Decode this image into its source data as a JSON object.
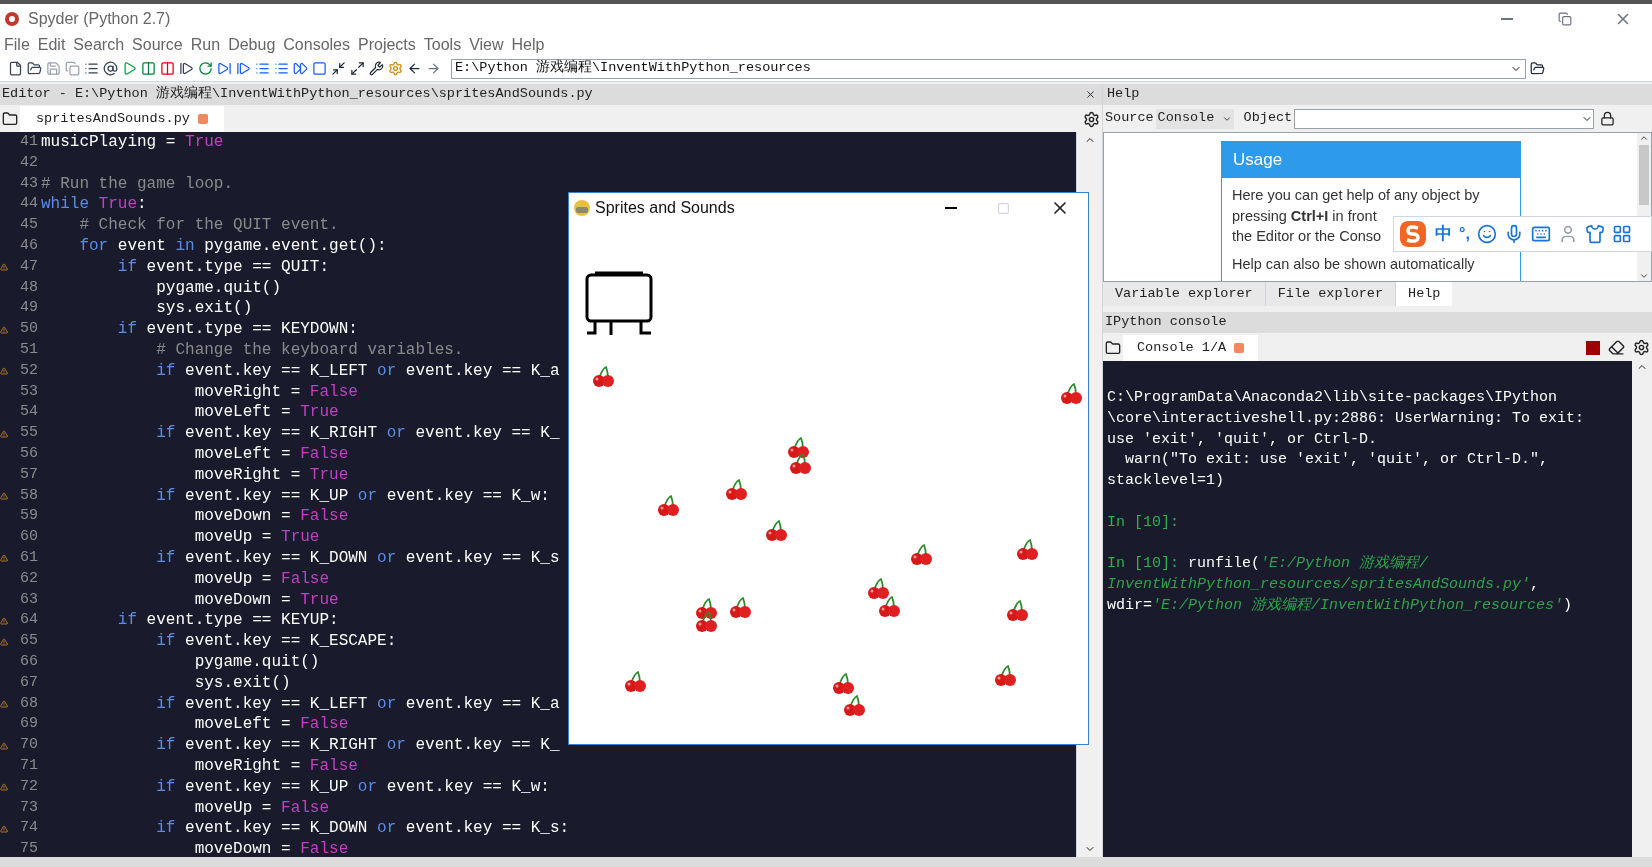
{
  "window": {
    "title": "Spyder (Python 2.7)"
  },
  "menu": [
    "File",
    "Edit",
    "Search",
    "Source",
    "Run",
    "Debug",
    "Consoles",
    "Projects",
    "Tools",
    "View",
    "Help"
  ],
  "path_field": {
    "value": "E:\\Python 游戏编程\\InventWithPython_resources"
  },
  "editor": {
    "header": "Editor - E:\\Python 游戏编程\\InventWithPython_resources\\spritesAndSounds.py",
    "tabs": [
      {
        "label": "spritesAndSounds.py",
        "selected": true
      }
    ],
    "lines": [
      {
        "n": "41",
        "warning": false,
        "tokens": [
          {
            "kind": "plain",
            "text": "musicPlaying = "
          },
          {
            "kind": "const",
            "text": "True"
          }
        ]
      },
      {
        "n": "42",
        "warning": false
      },
      {
        "n": "43",
        "warning": false,
        "tokens": [
          {
            "kind": "comment",
            "text": "# Run the game loop."
          }
        ]
      },
      {
        "n": "44",
        "warning": false,
        "tokens": [
          {
            "kind": "kw",
            "text": "while "
          },
          {
            "kind": "const",
            "text": "True"
          },
          {
            "kind": "plain",
            "text": ":"
          }
        ]
      },
      {
        "n": "45",
        "warning": false,
        "tokens": [
          {
            "kind": "comment",
            "text": "    # Check for the QUIT event."
          }
        ]
      },
      {
        "n": "46",
        "warning": false,
        "tokens": [
          {
            "kind": "kw",
            "text": "    for"
          },
          {
            "kind": "plain",
            "text": " event "
          },
          {
            "kind": "kw",
            "text": "in"
          },
          {
            "kind": "plain",
            "text": " pygame.event.get():"
          }
        ]
      },
      {
        "n": "47",
        "warning": true,
        "tokens": [
          {
            "kind": "kw",
            "text": "        if"
          },
          {
            "kind": "plain",
            "text": " event.type == QUIT:"
          }
        ]
      },
      {
        "n": "48",
        "warning": false,
        "tokens": [
          {
            "kind": "plain",
            "text": "            pygame.quit()"
          }
        ]
      },
      {
        "n": "49",
        "warning": false,
        "tokens": [
          {
            "kind": "plain",
            "text": "            sys.exit()"
          }
        ]
      },
      {
        "n": "50",
        "warning": true,
        "tokens": [
          {
            "kind": "kw",
            "text": "        if"
          },
          {
            "kind": "plain",
            "text": " event.type == KEYDOWN:"
          }
        ]
      },
      {
        "n": "51",
        "warning": false,
        "tokens": [
          {
            "kind": "comment",
            "text": "            # Change the keyboard variables."
          }
        ]
      },
      {
        "n": "52",
        "warning": true,
        "tokens": [
          {
            "kind": "kw",
            "text": "            if"
          },
          {
            "kind": "plain",
            "text": " event.key == K_LEFT "
          },
          {
            "kind": "kw",
            "text": "or"
          },
          {
            "kind": "plain",
            "text": " event.key == K_a"
          }
        ]
      },
      {
        "n": "53",
        "warning": false,
        "tokens": [
          {
            "kind": "plain",
            "text": "                moveRight = "
          },
          {
            "kind": "const",
            "text": "False"
          }
        ]
      },
      {
        "n": "54",
        "warning": false,
        "tokens": [
          {
            "kind": "plain",
            "text": "                moveLeft = "
          },
          {
            "kind": "const",
            "text": "True"
          }
        ]
      },
      {
        "n": "55",
        "warning": true,
        "tokens": [
          {
            "kind": "kw",
            "text": "            if"
          },
          {
            "kind": "plain",
            "text": " event.key == K_RIGHT "
          },
          {
            "kind": "kw",
            "text": "or"
          },
          {
            "kind": "plain",
            "text": " event.key == K_"
          }
        ]
      },
      {
        "n": "56",
        "warning": false,
        "tokens": [
          {
            "kind": "plain",
            "text": "                moveLeft = "
          },
          {
            "kind": "const",
            "text": "False"
          }
        ]
      },
      {
        "n": "57",
        "warning": false,
        "tokens": [
          {
            "kind": "plain",
            "text": "                moveRight = "
          },
          {
            "kind": "const",
            "text": "True"
          }
        ]
      },
      {
        "n": "58",
        "warning": true,
        "tokens": [
          {
            "kind": "kw",
            "text": "            if"
          },
          {
            "kind": "plain",
            "text": " event.key == K_UP "
          },
          {
            "kind": "kw",
            "text": "or"
          },
          {
            "kind": "plain",
            "text": " event.key == K_w:"
          }
        ]
      },
      {
        "n": "59",
        "warning": false,
        "tokens": [
          {
            "kind": "plain",
            "text": "                moveDown = "
          },
          {
            "kind": "const",
            "text": "False"
          }
        ]
      },
      {
        "n": "60",
        "warning": false,
        "tokens": [
          {
            "kind": "plain",
            "text": "                moveUp = "
          },
          {
            "kind": "const",
            "text": "True"
          }
        ]
      },
      {
        "n": "61",
        "warning": true,
        "tokens": [
          {
            "kind": "kw",
            "text": "            if"
          },
          {
            "kind": "plain",
            "text": " event.key == K_DOWN "
          },
          {
            "kind": "kw",
            "text": "or"
          },
          {
            "kind": "plain",
            "text": " event.key == K_s"
          }
        ]
      },
      {
        "n": "62",
        "warning": false,
        "tokens": [
          {
            "kind": "plain",
            "text": "                moveUp = "
          },
          {
            "kind": "const",
            "text": "False"
          }
        ]
      },
      {
        "n": "63",
        "warning": false,
        "tokens": [
          {
            "kind": "plain",
            "text": "                moveDown = "
          },
          {
            "kind": "const",
            "text": "True"
          }
        ]
      },
      {
        "n": "64",
        "warning": true,
        "tokens": [
          {
            "kind": "kw",
            "text": "        if"
          },
          {
            "kind": "plain",
            "text": " event.type == KEYUP:"
          }
        ]
      },
      {
        "n": "65",
        "warning": true,
        "tokens": [
          {
            "kind": "kw",
            "text": "            if"
          },
          {
            "kind": "plain",
            "text": " event.key == K_ESCAPE:"
          }
        ]
      },
      {
        "n": "66",
        "warning": false,
        "tokens": [
          {
            "kind": "plain",
            "text": "                pygame.quit()"
          }
        ]
      },
      {
        "n": "67",
        "warning": false,
        "tokens": [
          {
            "kind": "plain",
            "text": "                sys.exit()"
          }
        ]
      },
      {
        "n": "68",
        "warning": true,
        "tokens": [
          {
            "kind": "kw",
            "text": "            if"
          },
          {
            "kind": "plain",
            "text": " event.key == K_LEFT "
          },
          {
            "kind": "kw",
            "text": "or"
          },
          {
            "kind": "plain",
            "text": " event.key == K_a"
          }
        ]
      },
      {
        "n": "69",
        "warning": false,
        "tokens": [
          {
            "kind": "plain",
            "text": "                moveLeft = "
          },
          {
            "kind": "const",
            "text": "False"
          }
        ]
      },
      {
        "n": "70",
        "warning": true,
        "tokens": [
          {
            "kind": "kw",
            "text": "            if"
          },
          {
            "kind": "plain",
            "text": " event.key == K_RIGHT "
          },
          {
            "kind": "kw",
            "text": "or"
          },
          {
            "kind": "plain",
            "text": " event.key == K_"
          }
        ]
      },
      {
        "n": "71",
        "warning": false,
        "tokens": [
          {
            "kind": "plain",
            "text": "                moveRight = "
          },
          {
            "kind": "const",
            "text": "False"
          }
        ]
      },
      {
        "n": "72",
        "warning": true,
        "tokens": [
          {
            "kind": "kw",
            "text": "            if"
          },
          {
            "kind": "plain",
            "text": " event.key == K_UP "
          },
          {
            "kind": "kw",
            "text": "or"
          },
          {
            "kind": "plain",
            "text": " event.key == K_w:"
          }
        ]
      },
      {
        "n": "73",
        "warning": false,
        "tokens": [
          {
            "kind": "plain",
            "text": "                moveUp = "
          },
          {
            "kind": "const",
            "text": "False"
          }
        ]
      },
      {
        "n": "74",
        "warning": true,
        "tokens": [
          {
            "kind": "kw",
            "text": "            if"
          },
          {
            "kind": "plain",
            "text": " event.key == K_DOWN "
          },
          {
            "kind": "kw",
            "text": "or"
          },
          {
            "kind": "plain",
            "text": " event.key == K_s:"
          }
        ]
      },
      {
        "n": "75",
        "warning": false,
        "tokens": [
          {
            "kind": "plain",
            "text": "                moveDown = "
          },
          {
            "kind": "const",
            "text": "False"
          }
        ]
      }
    ]
  },
  "game_window": {
    "title": "Sprites and Sounds"
  },
  "help": {
    "title": "Help",
    "source_label": "Source",
    "source_value": "Console",
    "object_label": "Object",
    "card": {
      "title": "Usage",
      "paragraphs": [
        [
          "Here you can get help of any object by",
          "pressing **Ctrl+I** in front",
          "the Editor or the Conso"
        ],
        [
          "Help can also be shown automatically"
        ]
      ]
    },
    "tabs": [
      {
        "label": "Variable explorer",
        "selected": false
      },
      {
        "label": "File explorer",
        "selected": false
      },
      {
        "label": "Help",
        "selected": true
      }
    ]
  },
  "ime_bar": {
    "mode": "中",
    "punct": "°,"
  },
  "console": {
    "title": "IPython console",
    "tabs": [
      {
        "label": "Console 1/A",
        "selected": true
      }
    ],
    "blocks": [
      [
        [
          {
            "kind": "plain",
            "text": "C:\\ProgramData\\Anaconda2\\lib\\site-packages\\IPython"
          }
        ],
        [
          {
            "kind": "plain",
            "text": "\\core\\interactiveshell.py:2886: UserWarning: To exit:"
          }
        ],
        [
          {
            "kind": "plain",
            "text": "use 'exit', 'quit', or Ctrl-D."
          }
        ],
        [
          {
            "kind": "plain",
            "text": "  warn(\"To exit: use 'exit', 'quit', or Ctrl-D.\","
          }
        ],
        [
          {
            "kind": "plain",
            "text": "stacklevel=1)"
          }
        ]
      ],
      [
        [
          {
            "kind": "prompt",
            "text": "In [10]:"
          }
        ]
      ],
      [
        [
          {
            "kind": "prompt",
            "text": "In [10]:"
          },
          {
            "kind": "plain",
            "text": " runfile("
          },
          {
            "kind": "string",
            "text": "'E:/Python 游戏编程/"
          }
        ],
        [
          {
            "kind": "string",
            "text": "InventWithPython_resources/spritesAndSounds.py'"
          },
          {
            "kind": "plain",
            "text": ","
          }
        ],
        [
          {
            "kind": "plain",
            "text": "wdir="
          },
          {
            "kind": "string",
            "text": "'E:/Python 游戏编程/InventWithPython_resources'"
          },
          {
            "kind": "plain",
            "text": ")"
          }
        ]
      ]
    ]
  }
}
